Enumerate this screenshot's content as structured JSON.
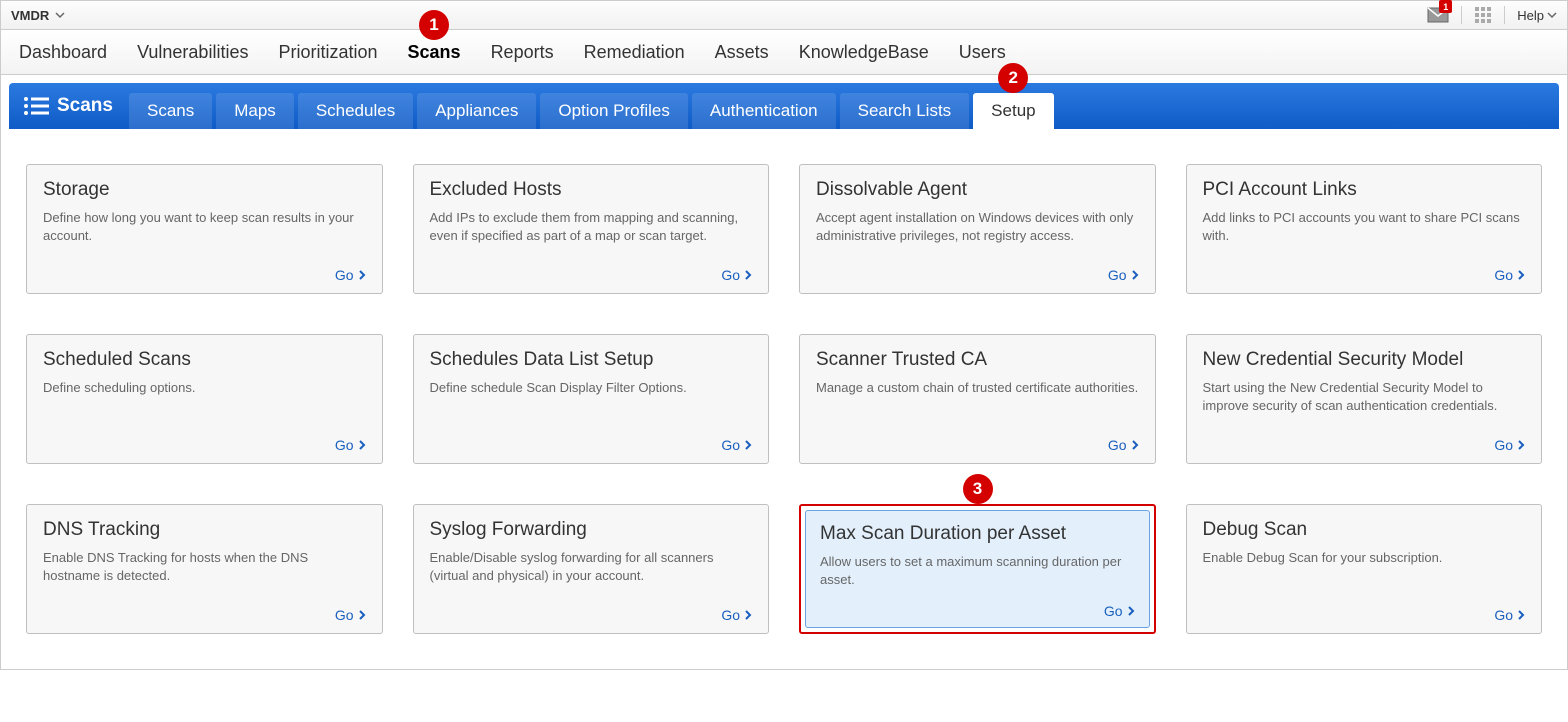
{
  "topbar": {
    "app_selector": "VMDR",
    "mail_badge": "1",
    "help": "Help"
  },
  "mainnav": [
    {
      "label": "Dashboard",
      "active": false
    },
    {
      "label": "Vulnerabilities",
      "active": false
    },
    {
      "label": "Prioritization",
      "active": false
    },
    {
      "label": "Scans",
      "active": true
    },
    {
      "label": "Reports",
      "active": false
    },
    {
      "label": "Remediation",
      "active": false
    },
    {
      "label": "Assets",
      "active": false
    },
    {
      "label": "KnowledgeBase",
      "active": false
    },
    {
      "label": "Users",
      "active": false
    }
  ],
  "subnav": {
    "title": "Scans",
    "tabs": [
      {
        "label": "Scans",
        "active": false
      },
      {
        "label": "Maps",
        "active": false
      },
      {
        "label": "Schedules",
        "active": false
      },
      {
        "label": "Appliances",
        "active": false
      },
      {
        "label": "Option Profiles",
        "active": false
      },
      {
        "label": "Authentication",
        "active": false
      },
      {
        "label": "Search Lists",
        "active": false
      },
      {
        "label": "Setup",
        "active": true
      }
    ]
  },
  "go_label": "Go",
  "cards": [
    {
      "title": "Storage",
      "desc": "Define how long you want to keep scan results in your account.",
      "highlight": false
    },
    {
      "title": "Excluded Hosts",
      "desc": "Add IPs to exclude them from mapping and scanning, even if specified as part of a map or scan target.",
      "highlight": false
    },
    {
      "title": "Dissolvable Agent",
      "desc": "Accept agent installation on Windows devices with only administrative privileges, not registry access.",
      "highlight": false
    },
    {
      "title": "PCI Account Links",
      "desc": "Add links to PCI accounts you want to share PCI scans with.",
      "highlight": false
    },
    {
      "title": "Scheduled Scans",
      "desc": "Define scheduling options.",
      "highlight": false
    },
    {
      "title": "Schedules Data List Setup",
      "desc": "Define schedule Scan Display Filter Options.",
      "highlight": false
    },
    {
      "title": "Scanner Trusted CA",
      "desc": "Manage a custom chain of trusted certificate authorities.",
      "highlight": false
    },
    {
      "title": "New Credential Security Model",
      "desc": "Start using the New Credential Security Model to improve security of scan authentication credentials.",
      "highlight": false
    },
    {
      "title": "DNS Tracking",
      "desc": "Enable DNS Tracking for hosts when the DNS hostname is detected.",
      "highlight": false
    },
    {
      "title": "Syslog Forwarding",
      "desc": "Enable/Disable syslog forwarding for all scanners (virtual and physical) in your account.",
      "highlight": false
    },
    {
      "title": "Max Scan Duration per Asset",
      "desc": "Allow users to set a maximum scanning duration per asset.",
      "highlight": true
    },
    {
      "title": "Debug Scan",
      "desc": "Enable Debug Scan for your subscription.",
      "highlight": false
    }
  ],
  "annotations": {
    "1": "1",
    "2": "2",
    "3": "3"
  }
}
